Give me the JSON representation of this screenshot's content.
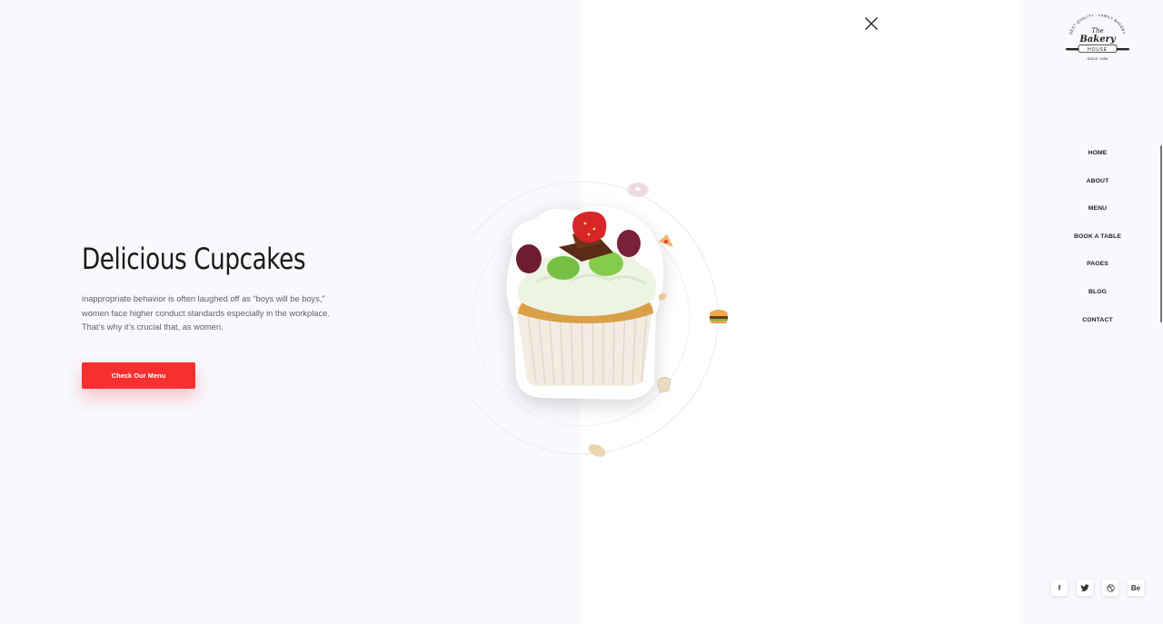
{
  "hero": {
    "title": "Delicious Cupcakes",
    "description": "inappropriate behavior is often laughed off as “boys will be boys,” women face higher conduct standards especially in the workplace. That’s why it’s crucial that, as women.",
    "cta_label": "Check Our Menu"
  },
  "logo": {
    "top_arc": "BEST QUALITY · FAMILY BAKERY",
    "the": "The",
    "name": "Bakery",
    "banner": "HOUSE",
    "since": "SINCE 1950"
  },
  "nav": {
    "items": [
      {
        "label": "HOME"
      },
      {
        "label": "ABOUT"
      },
      {
        "label": "MENU"
      },
      {
        "label": "BOOK A TABLE"
      },
      {
        "label": "PAGES"
      },
      {
        "label": "BLOG"
      },
      {
        "label": "CONTACT"
      }
    ]
  },
  "social": {
    "facebook": "f",
    "twitter": "twitter-icon",
    "dribbble": "dribbble-icon",
    "behance": "Be"
  },
  "colors": {
    "accent": "#f72f2f",
    "panel_bg": "#f8f8fd"
  }
}
